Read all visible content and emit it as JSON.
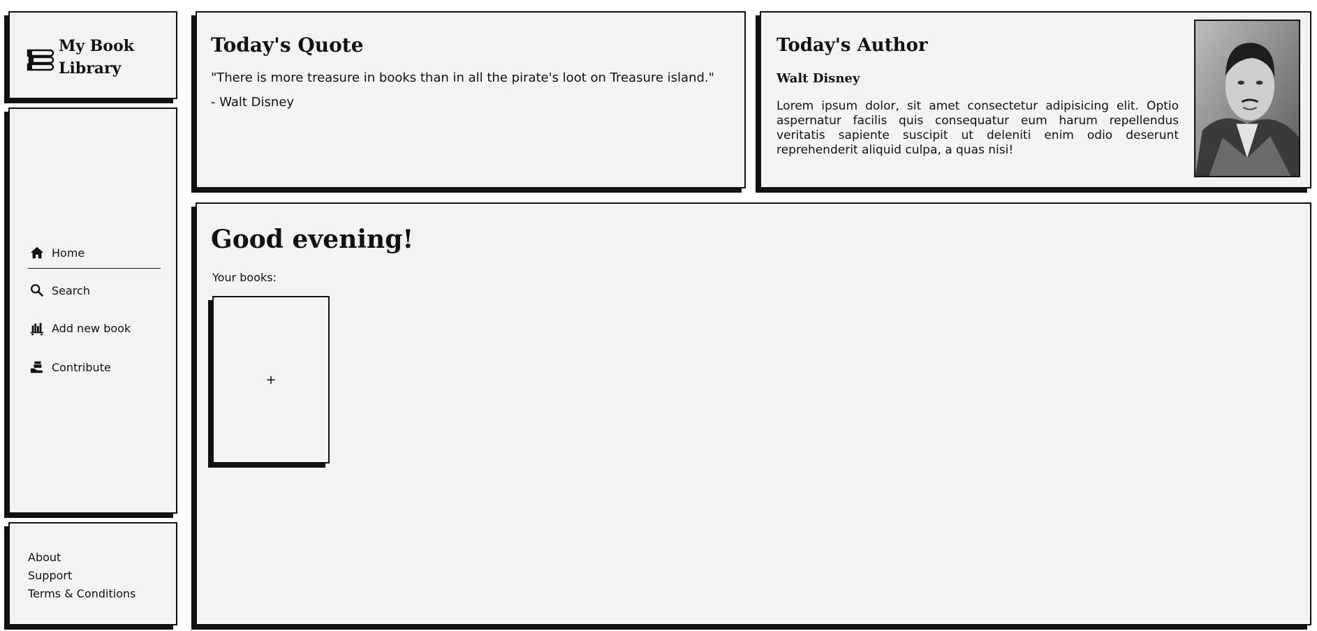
{
  "app": {
    "title": "My Book Library"
  },
  "nav": {
    "items": [
      {
        "label": "Home",
        "icon": "home-icon"
      },
      {
        "label": "Search",
        "icon": "search-icon"
      },
      {
        "label": "Add new book",
        "icon": "bookshelf-icon"
      },
      {
        "label": "Contribute",
        "icon": "hand-book-icon"
      }
    ]
  },
  "footer": {
    "links": [
      "About",
      "Support",
      "Terms & Conditions"
    ]
  },
  "quote": {
    "title": "Today's Quote",
    "text": "\"There is more treasure in books than in all the pirate's loot on Treasure island.\"",
    "attribution": "- Walt Disney"
  },
  "author": {
    "title": "Today's Author",
    "name": "Walt Disney",
    "bio": "Lorem ipsum dolor, sit amet consectetur adipisicing elit. Optio aspernatur facilis quis consequatur eum harum repellendus veritatis sapiente suscipit ut deleniti enim odio deserunt reprehenderit aliquid culpa, a quas nisi!",
    "portrait_icon": "author-portrait"
  },
  "main": {
    "greeting": "Good evening!",
    "books_label": "Your books:",
    "add_book_label": "+"
  }
}
